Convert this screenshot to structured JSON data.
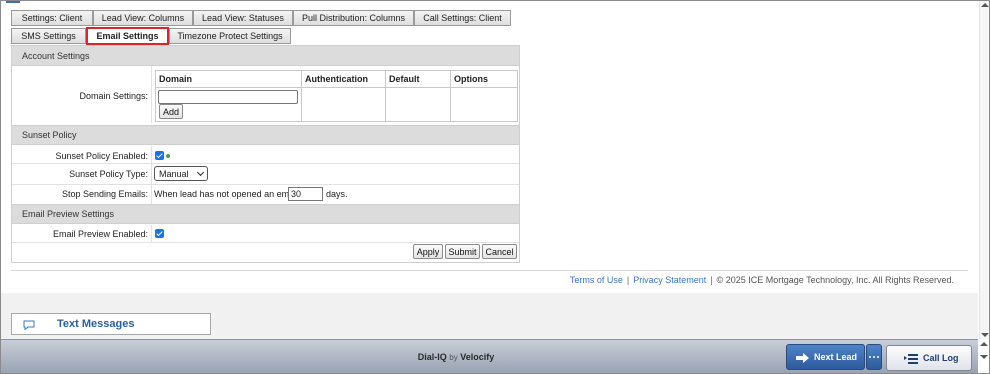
{
  "tabs": {
    "row1": [
      "Settings: Client",
      "Lead View: Columns",
      "Lead View: Statuses",
      "Pull Distribution: Columns",
      "Call Settings: Client"
    ],
    "row2": [
      "SMS Settings",
      "Email Settings",
      "Timezone Protect Settings"
    ],
    "active": "Email Settings"
  },
  "account_settings": {
    "title": "Account Settings",
    "domain_label": "Domain Settings:",
    "columns": [
      "Domain",
      "Authentication",
      "Default",
      "Options"
    ],
    "domain_value": "",
    "add_button": "Add"
  },
  "sunset_policy": {
    "title": "Sunset Policy",
    "enabled_label": "Sunset Policy Enabled:",
    "enabled": true,
    "type_label": "Sunset Policy Type:",
    "type_value": "Manual",
    "stop_label": "Stop Sending Emails:",
    "stop_prefix": "When lead has not opened an email in",
    "stop_days": "30",
    "stop_suffix": "days."
  },
  "email_preview": {
    "title": "Email Preview Settings",
    "enabled_label": "Email Preview Enabled:",
    "enabled": true
  },
  "actions": {
    "apply": "Apply",
    "submit": "Submit",
    "cancel": "Cancel"
  },
  "footer": {
    "terms": "Terms of Use",
    "separator": "|",
    "privacy": "Privacy Statement",
    "copyright": "© 2025 ICE Mortgage Technology, Inc. All Rights Reserved."
  },
  "text_messages": {
    "label": "Text Messages",
    "icon": "chat-bubble-icon"
  },
  "bottom_bar": {
    "brand": "Dial-IQ",
    "by": "by",
    "brand_suffix": "Velocify",
    "next_lead": "Next Lead",
    "call_log": "Call Log"
  },
  "colors": {
    "active_tab_border": "#d9262b",
    "link": "#3a78c2",
    "checkbox": "#1a73e8",
    "next_lead_bg": "#2d5b9c"
  }
}
